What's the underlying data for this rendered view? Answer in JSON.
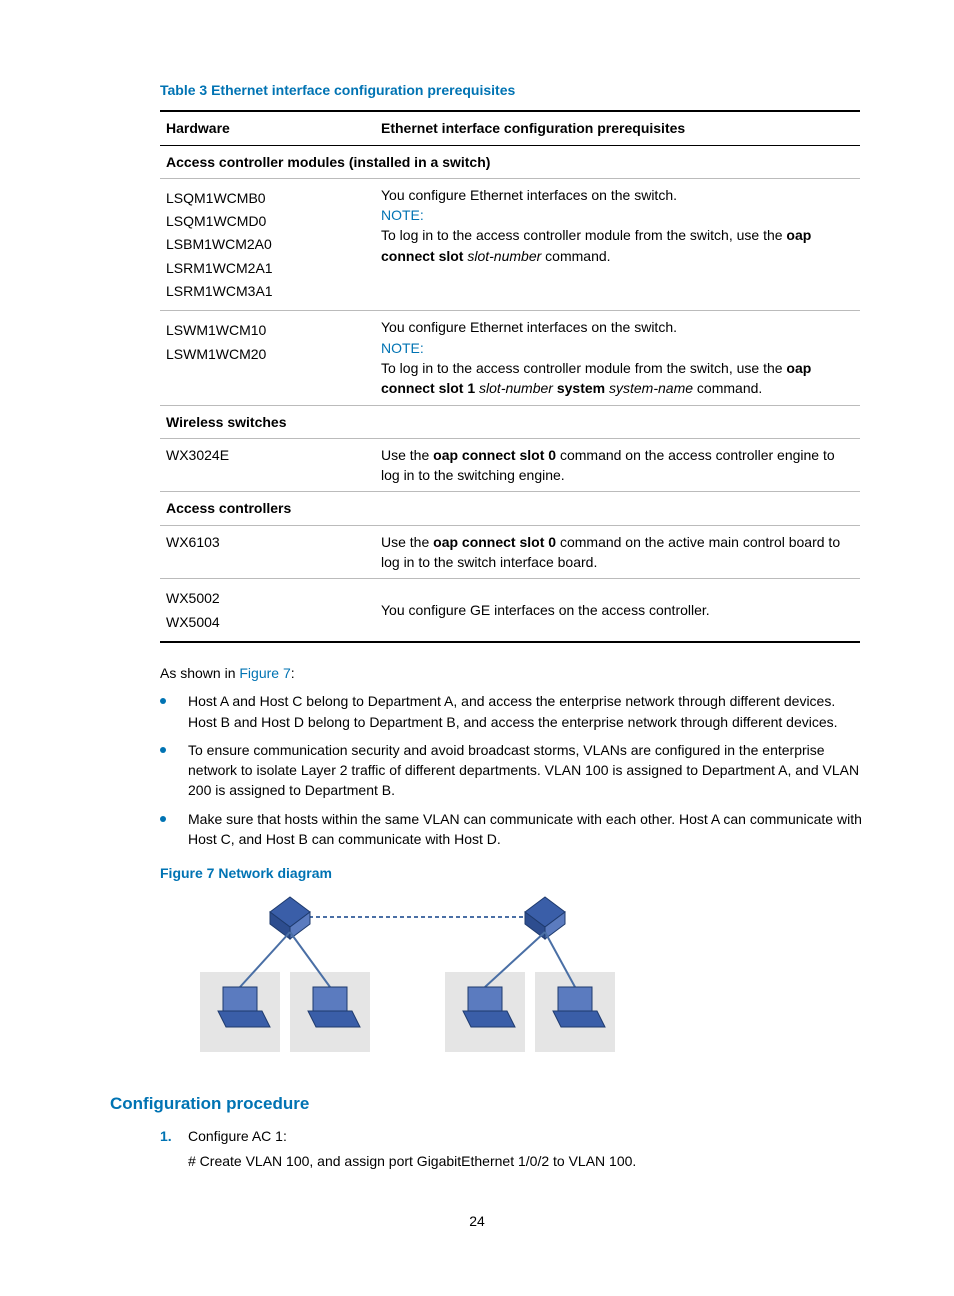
{
  "table": {
    "caption": "Table 3 Ethernet interface configuration prerequisites",
    "headers": [
      "Hardware",
      "Ethernet interface configuration prerequisites"
    ],
    "section1": "Access controller modules (installed in a switch)",
    "row1": {
      "hw": [
        "LSQM1WCMB0",
        "LSQM1WCMD0",
        "LSBM1WCM2A0",
        "LSRM1WCM2A1",
        "LSRM1WCM3A1"
      ],
      "line1": "You configure Ethernet interfaces on the switch.",
      "note": "NOTE:",
      "line2a": "To log in to the access controller module from the switch, use the ",
      "line2b": "oap connect slot",
      "line2c": " ",
      "line2d": "slot-number",
      "line2e": " command."
    },
    "row2": {
      "hw": [
        "LSWM1WCM10",
        "LSWM1WCM20"
      ],
      "line1": "You configure Ethernet interfaces on the switch.",
      "note": "NOTE:",
      "line2a": "To log in to the access controller module from the switch, use the ",
      "line2b": "oap connect slot 1",
      "line2c": " ",
      "line2d": "slot-number",
      "line2e": " ",
      "line2f": "system",
      "line2g": " ",
      "line2h": "system-name",
      "line2i": " command."
    },
    "section2": "Wireless switches",
    "row3": {
      "hw": "WX3024E",
      "text_a": "Use the ",
      "text_b": "oap connect slot 0",
      "text_c": " command on the access controller engine to log in to the switching engine."
    },
    "section3": "Access controllers",
    "row4": {
      "hw": "WX6103",
      "text_a": "Use the ",
      "text_b": "oap connect slot 0",
      "text_c": " command on the active main control board to log in to the switch interface board."
    },
    "row5": {
      "hw": [
        "WX5002",
        "WX5004"
      ],
      "text": "You configure GE interfaces on the access controller."
    }
  },
  "intro_a": "As shown in ",
  "intro_link": "Figure 7",
  "intro_b": ":",
  "bullets": [
    "Host A and Host C belong to Department A, and access the enterprise network through different devices. Host B and Host D belong to Department B, and access the enterprise network through different devices.",
    "To ensure communication security and avoid broadcast storms, VLANs are configured in the enterprise network to isolate Layer 2 traffic of different departments. VLAN 100 is assigned to Department A, and VLAN 200 is assigned to Department B.",
    "Make sure that hosts within the same VLAN can communicate with each other. Host A can communicate with Host C, and Host B can communicate with Host D."
  ],
  "figure_caption": "Figure 7 Network diagram",
  "h3": "Configuration procedure",
  "step1": "Configure AC 1:",
  "substep1": "# Create VLAN 100, and assign port GigabitEthernet 1/0/2 to VLAN 100.",
  "page": "24"
}
